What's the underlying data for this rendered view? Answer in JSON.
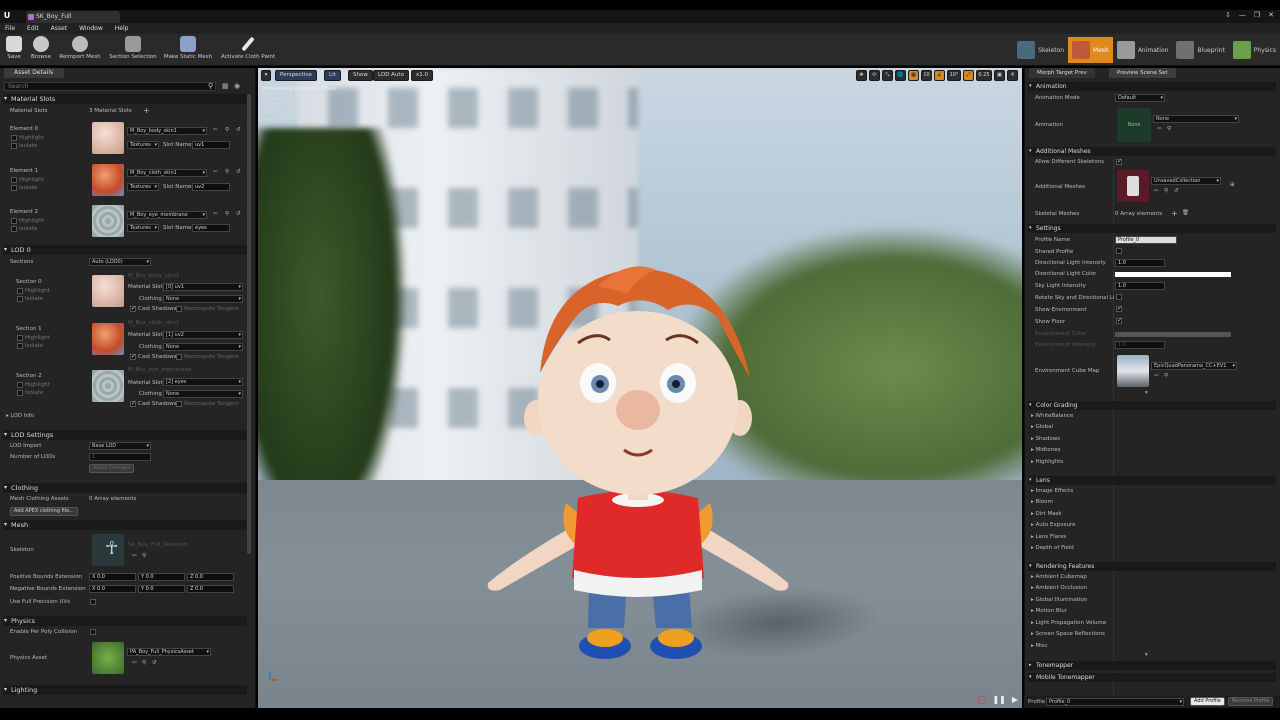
{
  "app": {
    "logo": "U",
    "tab_title": "SK_Boy_Full",
    "window_controls": [
      "⇩",
      "—",
      "❐",
      "✕"
    ]
  },
  "menu": [
    "File",
    "Edit",
    "Asset",
    "Window",
    "Help"
  ],
  "toolbar": [
    "Save",
    "Browse",
    "Reimport Mesh",
    "Section Selection",
    "Make Static Mesh",
    "Activate Cloth Paint"
  ],
  "modes": [
    "Skeleton",
    "Mesh",
    "Animation",
    "Blueprint",
    "Physics"
  ],
  "left": {
    "tab": "Asset Details",
    "search_placeholder": "Search",
    "material_slots": {
      "header": "Material Slots",
      "label": "Material Slots",
      "count": "3 Material Slots",
      "elements": [
        {
          "name": "Element 0",
          "material": "M_Boy_body_skin1",
          "slot_name": "uv1"
        },
        {
          "name": "Element 1",
          "material": "M_Boy_cloth_skin1",
          "slot_name": "uv2"
        },
        {
          "name": "Element 2",
          "material": "M_Boy_eye_membrane",
          "slot_name": "eyes"
        }
      ],
      "highlight": "Highlight",
      "isolate": "Isolate",
      "textures": "Textures",
      "slot_name_label": "Slot Name"
    },
    "lod0": {
      "header": "LOD 0",
      "sections_label": "Sections",
      "sections_value": "Auto (LOD0)",
      "sections": [
        {
          "name": "Section 0",
          "material_hint": "M_Boy_body_skin1",
          "slot": "[0] uv1"
        },
        {
          "name": "Section 1",
          "material_hint": "M_Boy_cloth_skin1",
          "slot": "[1] uv2"
        },
        {
          "name": "Section 2",
          "material_hint": "M_Boy_eye_membrane",
          "slot": "[2] eyes"
        }
      ],
      "material_slot_label": "Material Slot",
      "clothing_label": "Clothing",
      "clothing_value": "None",
      "cast_shadows": "Cast Shadows",
      "recompute_tangent": "Recompute Tangent",
      "lod_info": "LOD Info"
    },
    "lod_settings": {
      "header": "LOD Settings",
      "lod_import_label": "LOD Import",
      "lod_import_value": "Base LOD",
      "num_lods_label": "Number of LODs",
      "num_lods_value": "1",
      "apply_changes": "Apply Changes"
    },
    "clothing": {
      "header": "Clothing",
      "mesh_clothing_label": "Mesh Clothing Assets",
      "mesh_clothing_value": "0 Array elements",
      "add_button": "Add APEX clothing file..."
    },
    "mesh": {
      "header": "Mesh",
      "skeleton_label": "Skeleton",
      "skeleton_value": "SK_Boy_Full_Skeleton",
      "pos_bounds_label": "Positive Bounds Extension",
      "neg_bounds_label": "Negative Bounds Extension",
      "pos_bounds": [
        "X 0.0",
        "Y 0.0",
        "Z 0.0"
      ],
      "neg_bounds": [
        "X 0.0",
        "Y 0.0",
        "Z 0.0"
      ],
      "full_precision_label": "Use Full Precision UVs"
    },
    "physics": {
      "header": "Physics",
      "per_poly_label": "Enable Per Poly Collision",
      "asset_label": "Physics Asset",
      "asset_value": "PA_Boy_Full_PhysicsAsset"
    },
    "lighting": {
      "header": "Lighting"
    }
  },
  "viewport": {
    "buttons": [
      "Perspective",
      "Lit",
      "Show",
      "LOD Auto",
      "x1.0"
    ],
    "info_title": "Previewing Reference Pose",
    "info_lines": [
      "LOD: 0",
      "Current Screen Size: 1.00",
      "Triangles: 23,184",
      "Vertices: 13,248",
      "UV Channels: 1",
      "Approx Size: 66x32x134"
    ],
    "right_tools": [
      "✥",
      "⟳",
      "⤡",
      "🌐",
      "▦",
      "10",
      "∠",
      "10°",
      "⤢",
      "0.25",
      "▣",
      "4"
    ]
  },
  "right": {
    "tabs": [
      "Morph Target Prev",
      "Preview Scene Set"
    ],
    "animation": {
      "header": "Animation",
      "mode_label": "Animation Mode",
      "mode_value": "Default",
      "anim_label": "Animation",
      "anim_thumb": "None",
      "anim_value": "None"
    },
    "additional_meshes": {
      "header": "Additional Meshes",
      "allow_label": "Allow Different Skeletons",
      "meshes_label": "Additional Meshes",
      "meshes_value": "UnsavedCollection",
      "skeletal_label": "Skeletal Meshes",
      "skeletal_value": "0 Array elements"
    },
    "settings": {
      "header": "Settings",
      "profile_name_label": "Profile Name",
      "profile_name_value": "Profile_0",
      "shared_label": "Shared Profile",
      "dir_intensity_label": "Directional Light Intensity",
      "dir_intensity_value": "1.0",
      "dir_color_label": "Directional Light Color",
      "sky_intensity_label": "Sky Light Intensity",
      "sky_intensity_value": "1.0",
      "rotate_label": "Rotate Sky and Directional Li",
      "show_env_label": "Show Environment",
      "show_floor_label": "Show Floor",
      "env_color_label": "Environment Color",
      "env_intensity_label": "Environment Intensity",
      "env_intensity_value": "1.0",
      "cube_label": "Environment Cube Map",
      "cube_value": "EpicQuadPanorama_CC+EV1"
    },
    "color_grading": {
      "header": "Color Grading",
      "items": [
        "WhiteBalance",
        "Global",
        "Shadows",
        "Midtones",
        "Highlights"
      ]
    },
    "lens": {
      "header": "Lens",
      "items": [
        "Image Effects",
        "Bloom",
        "Dirt Mask",
        "Auto Exposure",
        "Lens Flares",
        "Depth of Field"
      ]
    },
    "rendering": {
      "header": "Rendering Features",
      "items": [
        "Ambient Cubemap",
        "Ambient Occlusion",
        "Global Illumination",
        "Motion Blur",
        "Light Propagation Volume",
        "Screen Space Reflections",
        "Misc"
      ]
    },
    "tonemapper": "Tonemapper",
    "mobile_tonemapper": "Mobile Tonemapper",
    "bottom": {
      "profile_label": "Profile",
      "profile_value": "Profile_0",
      "add": "Add Profile",
      "remove": "Remove Profile"
    }
  },
  "colors": {
    "accent": "#e08a1e",
    "panel": "#242424",
    "header": "#1a1a1a",
    "shirt": "#e02a2a",
    "hair": "#d9642a",
    "jeans": "#4a6fa8"
  }
}
